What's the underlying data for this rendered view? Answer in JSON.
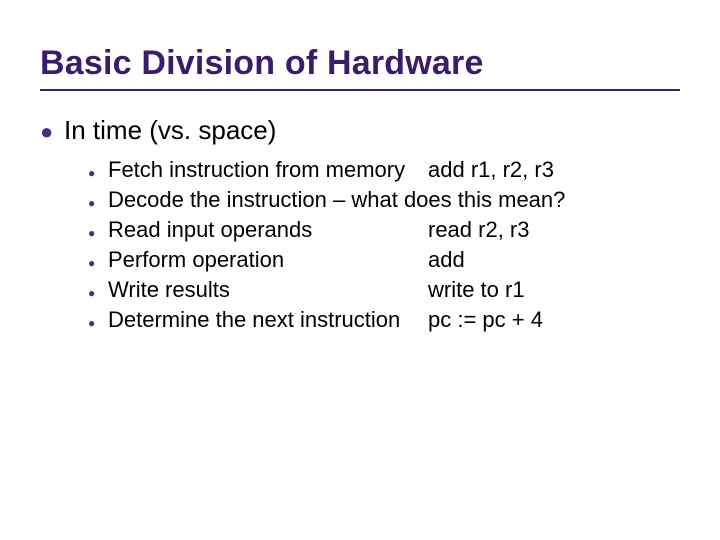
{
  "title": "Basic Division of Hardware",
  "level1": {
    "text": "In time (vs. space)"
  },
  "sub": [
    {
      "left": "Fetch instruction from memory",
      "right": "add r1, r2, r3",
      "full": ""
    },
    {
      "left": "",
      "right": "",
      "full": "Decode the instruction – what does this mean?"
    },
    {
      "left": "Read input operands",
      "right": "read r2, r3",
      "full": ""
    },
    {
      "left": "Perform operation",
      "right": "add",
      "full": ""
    },
    {
      "left": "Write results",
      "right": "write to r1",
      "full": ""
    },
    {
      "left": "Determine the next instruction",
      "right": "pc := pc + 4",
      "full": ""
    }
  ]
}
